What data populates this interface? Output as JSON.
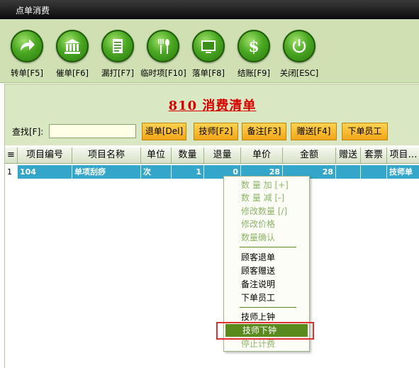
{
  "window": {
    "title": "点单消费"
  },
  "toolbar": {
    "buttons": [
      {
        "label": "转单[F5]",
        "icon": "arrow-transfer-icon"
      },
      {
        "label": "催单[F6]",
        "icon": "building-icon"
      },
      {
        "label": "漏打[F7]",
        "icon": "document-icon"
      },
      {
        "label": "临时项[F10]",
        "icon": "utensils-icon"
      },
      {
        "label": "落单[F8]",
        "icon": "screen-icon"
      },
      {
        "label": "结账[F9]",
        "icon": "dollar-icon"
      },
      {
        "label": "关闭[ESC]",
        "icon": "power-icon"
      }
    ]
  },
  "main": {
    "title": "810 消费清单",
    "search": {
      "label": "查找[F]:",
      "value": ""
    },
    "actions": [
      {
        "label": "退单[Del]"
      },
      {
        "label": "技师[F2]"
      },
      {
        "label": "备注[F3]"
      },
      {
        "label": "赠送[F4]"
      },
      {
        "label": "下单员工"
      }
    ]
  },
  "table": {
    "corner_glyph": "≡",
    "columns": [
      "项目编号",
      "项目名称",
      "单位",
      "数量",
      "退量",
      "单价",
      "金额",
      "赠送",
      "套票",
      "项目…"
    ],
    "rows": [
      {
        "index": "1",
        "cells": [
          "104",
          "单项刮痧",
          "次",
          "1",
          "0",
          "28",
          "28",
          "",
          "",
          "技师单"
        ]
      }
    ]
  },
  "context_menu": {
    "groups": [
      [
        {
          "label": "数 量 加 [+]",
          "state": "disabled"
        },
        {
          "label": "数 量 减 [-]",
          "state": "disabled"
        },
        {
          "label": "修改数量 [/]",
          "state": "disabled"
        },
        {
          "label": "修改价格",
          "state": "disabled"
        },
        {
          "label": "数量确认",
          "state": "disabled"
        }
      ],
      [
        {
          "label": "顾客退单",
          "state": "enabled"
        },
        {
          "label": "顾客赠送",
          "state": "enabled"
        },
        {
          "label": "备注说明",
          "state": "enabled"
        },
        {
          "label": "下单员工",
          "state": "enabled"
        }
      ],
      [
        {
          "label": "技师上钟",
          "state": "enabled"
        },
        {
          "label": "技师下钟",
          "state": "selected"
        },
        {
          "label": "停止计费",
          "state": "disabled"
        }
      ]
    ]
  },
  "colors": {
    "toolbar_bg": "#cfe0b3",
    "title_red": "#d40000",
    "row_selected": "#33a6c9",
    "menu_selected": "#5a8a1e",
    "button_orange": "#f2a517",
    "highlight": "#e03030"
  }
}
